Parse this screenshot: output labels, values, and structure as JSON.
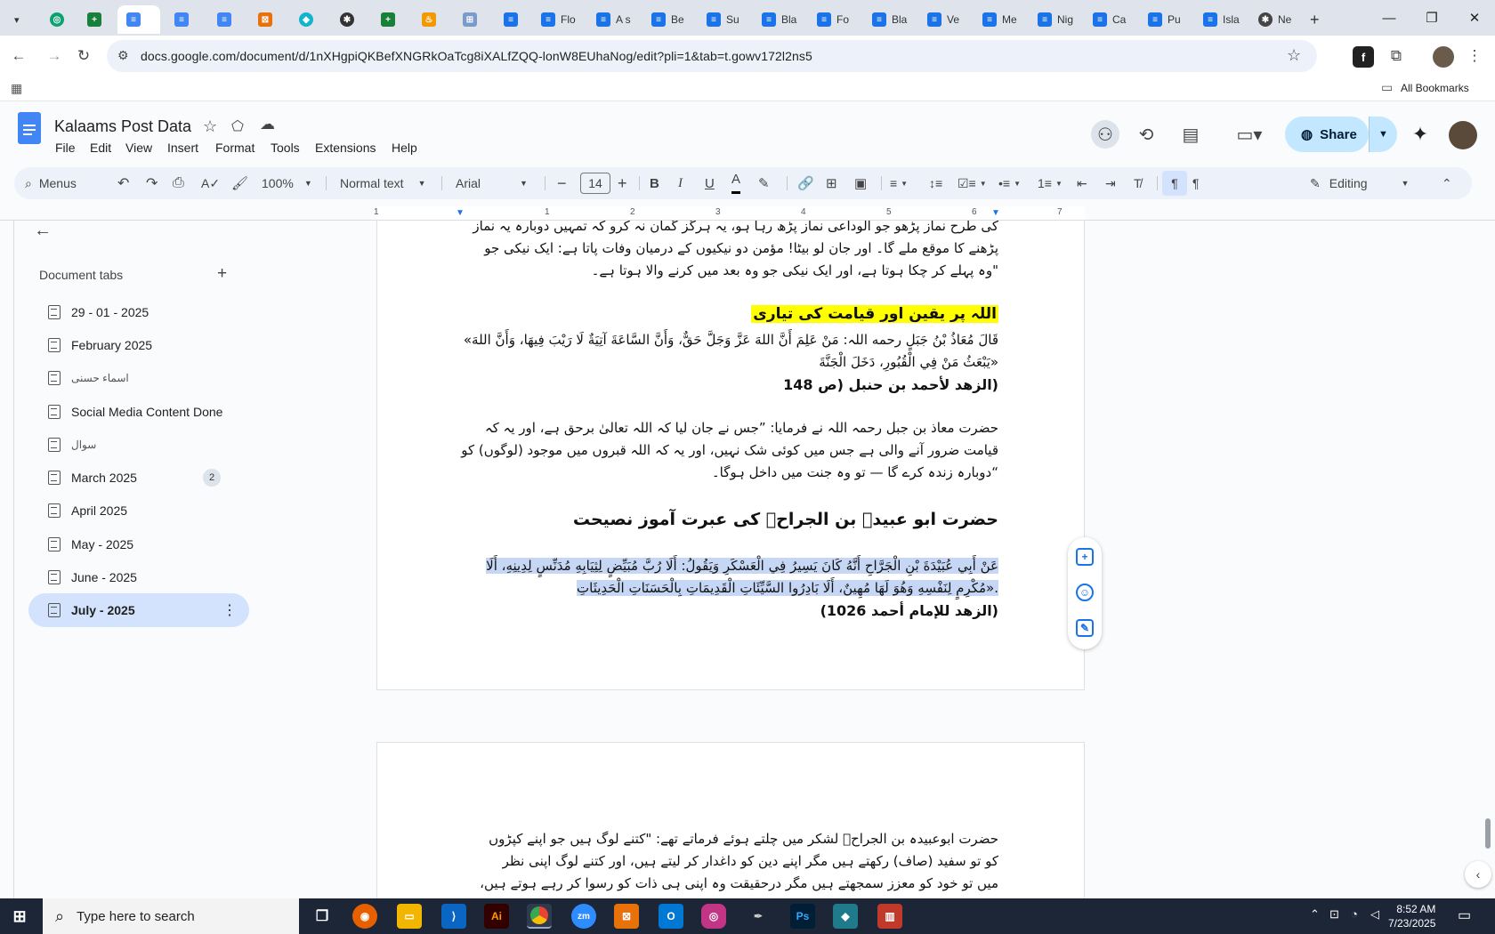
{
  "browser": {
    "tabs": [
      {
        "label": "",
        "icon": "chevron-down"
      },
      {
        "label": "",
        "icon": "globe"
      },
      {
        "label": "",
        "icon": "sheets"
      },
      {
        "label": "",
        "icon": "docs"
      },
      {
        "label": "",
        "icon": "docs"
      },
      {
        "label": "",
        "icon": "docs"
      },
      {
        "label": "",
        "icon": "app"
      },
      {
        "label": "",
        "icon": "app"
      },
      {
        "label": "",
        "icon": "chatgpt"
      },
      {
        "label": "",
        "icon": "sheets"
      },
      {
        "label": "",
        "icon": "app"
      },
      {
        "label": "",
        "icon": "app"
      },
      {
        "label": "Flo",
        "icon": "docs"
      },
      {
        "label": "A s",
        "icon": "docs"
      },
      {
        "label": "Be",
        "icon": "docs"
      },
      {
        "label": "Su",
        "icon": "docs"
      },
      {
        "label": "Bla",
        "icon": "docs"
      },
      {
        "label": "Fo",
        "icon": "docs"
      },
      {
        "label": "Bla",
        "icon": "docs"
      },
      {
        "label": "Ve",
        "icon": "docs"
      },
      {
        "label": "Me",
        "icon": "docs"
      },
      {
        "label": "Nig",
        "icon": "docs"
      },
      {
        "label": "Ca",
        "icon": "docs"
      },
      {
        "label": "Pu",
        "icon": "docs"
      },
      {
        "label": "Isla",
        "icon": "docs"
      },
      {
        "label": "Ne",
        "icon": "chatgpt"
      }
    ],
    "url": "docs.google.com/document/d/1nXHgpiQKBefXNGRkOaTcg8iXALfZQQ-lonW8EUhaNog/edit?pli=1&tab=t.gowv172l2ns5",
    "all_bookmarks": "All Bookmarks"
  },
  "doc": {
    "title": "Kalaams Post Data",
    "menus": [
      "File",
      "Edit",
      "View",
      "Insert",
      "Format",
      "Tools",
      "Extensions",
      "Help"
    ],
    "share": "Share"
  },
  "toolbar": {
    "menus_search": "Menus",
    "zoom": "100%",
    "style": "Normal text",
    "font": "Arial",
    "font_size": "14",
    "mode": "Editing"
  },
  "ruler": {
    "marks": [
      "1",
      "1",
      "2",
      "3",
      "4",
      "5",
      "6",
      "7"
    ]
  },
  "sidebar": {
    "heading": "Document tabs",
    "items": [
      {
        "label": "29 - 01 - 2025"
      },
      {
        "label": "February 2025"
      },
      {
        "label": "اسماء حسنی"
      },
      {
        "label": "Social Media Content Done"
      },
      {
        "label": "سوال"
      },
      {
        "label": "March 2025",
        "badge": "2"
      },
      {
        "label": "April 2025"
      },
      {
        "label": "May - 2025"
      },
      {
        "label": "June - 2025"
      },
      {
        "label": "July - 2025"
      }
    ]
  },
  "content": {
    "p1_line1": "کی طرح نماز پڑھو جو الوداعی نماز پڑھ رہا ہو، یہ ہرگز گمان نہ کرو کہ تمہیں دوبارہ یہ نماز",
    "p1_line2": "پڑھنے کا موقع ملے گا۔ اور جان لو بیٹا! مؤمن دو نیکیوں کے درمیان وفات پاتا ہے: ایک نیکی جو",
    "p1_line3": "\"وہ پہلے کر چکا ہوتا ہے، اور ایک نیکی جو وہ بعد میں کرنے والا ہوتا ہے۔",
    "heading1": "اللہ پر یقین اور قیامت کی تیاری",
    "ar1_line1": "قَالَ مُعَاذُ بْنُ جَبَلٍ رحمه اللہ: مَنْ عَلِمَ أَنَّ اللهَ عَزَّ وَجَلَّ حَقٌّ، وَأَنَّ السَّاعَةَ آتِيَةٌ لَا رَيْبَ فِيهَا، وَأَنَّ اللهَ»",
    "ar1_line2": "«يَبْعَثُ مَنْ فِي الْقُبُورِ، دَخَلَ الْجَنَّةَ",
    "ref1": "(الزهد لأحمد بن حنبل (ص 148",
    "p2_line1": "حضرت معاذ بن جبل رحمہ اللہ نے فرمایا: ”جس نے جان لیا کہ اللہ تعالیٰ برحق ہے، اور یہ کہ",
    "p2_line2": "قیامت ضرور آنے والی ہے جس میں کوئی شک نہیں، اور یہ کہ اللہ قبروں میں موجود (لوگوں) کو",
    "p2_line3": "“دوبارہ زندہ کرے گا — تو وہ جنت میں داخل ہوگا۔",
    "heading2": "حضرت ابو عبیدہ بن الجراحؓ کی عبرت آموز نصیحت",
    "ar2_line1": "عَنْ أَبِي عُبَيْدَةَ بْنِ الْجَرَّاحِ أَنَّهُ كَانَ يَسِيرُ فِي الْعَسْكَرِ وَيَقُولُ: أَلَا رُبَّ مُبَيِّضٍ لِثِيَابِهِ مُدَنِّسٍ لِدِينِهِ، أَلَا رُبَّ»",
    "ar2_line2": ".«مُكْرِمٍ لِنَفْسِهِ وَهُوَ لَهَا مُهِينٌ، أَلَا بَادِرُوا السَّيِّئَاتِ الْقَدِيمَاتِ بِالْحَسَنَاتِ الْحَدِيثَاتِ",
    "ref2": "(الزهد للإمام أحمد 1026)",
    "p3_line1": "حضرت ابوعبیدہ بن الجراحؓ لشکر میں چلتے ہوئے فرماتے تھے: \"کتنے لوگ ہیں جو اپنے کپڑوں",
    "p3_line2": "کو تو سفید (صاف) رکھتے ہیں مگر اپنے دین کو داغدار کر لیتے ہیں، اور کتنے لوگ اپنی نظر",
    "p3_line3": "میں تو خود کو معزز سمجھتے ہیں مگر درحقیقت وہ اپنی ہی ذات کو رسوا کر رہے ہوتے ہیں،"
  },
  "taskbar": {
    "search_placeholder": "Type here to search",
    "time": "8:52 AM",
    "date": "7/23/2025"
  },
  "colors": {
    "highlight_yellow": "#ffff00",
    "selection_blue": "#c6d7f5",
    "share_bg": "#c2e7ff",
    "active_tab_bg": "#d3e3fd",
    "docs_blue": "#4285f4"
  }
}
